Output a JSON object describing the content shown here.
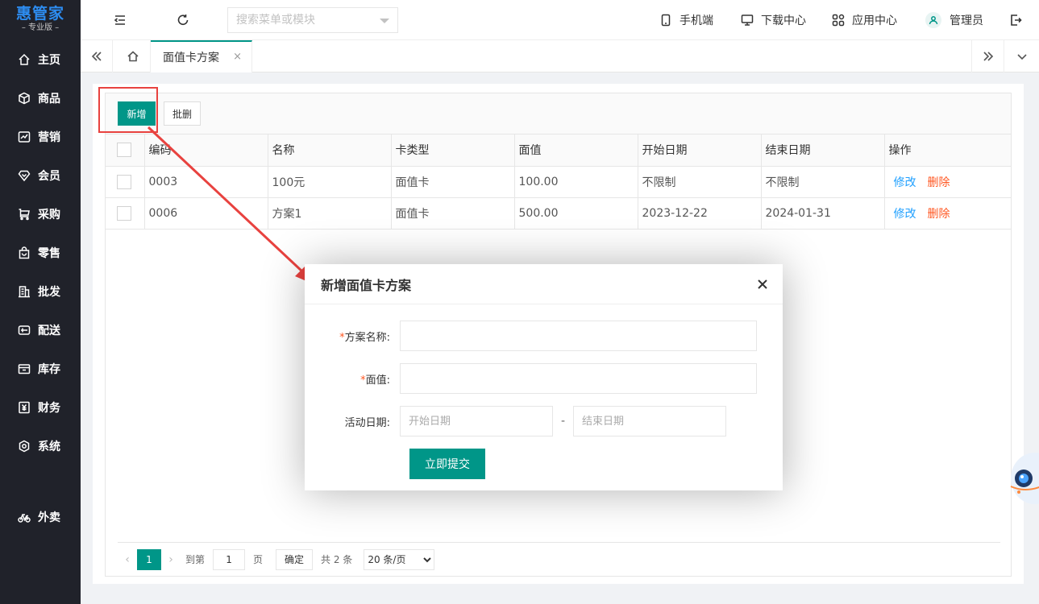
{
  "brand": {
    "title": "惠管家",
    "subtitle": "– 专业版 –"
  },
  "sidebar": {
    "items": [
      {
        "label": "主页",
        "icon": "home-icon"
      },
      {
        "label": "商品",
        "icon": "cube-icon"
      },
      {
        "label": "营销",
        "icon": "chart-icon"
      },
      {
        "label": "会员",
        "icon": "diamond-icon"
      },
      {
        "label": "采购",
        "icon": "cart-icon"
      },
      {
        "label": "零售",
        "icon": "bag-icon"
      },
      {
        "label": "批发",
        "icon": "building-icon"
      },
      {
        "label": "配送",
        "icon": "truck-icon"
      },
      {
        "label": "库存",
        "icon": "box-icon"
      },
      {
        "label": "财务",
        "icon": "yen-icon"
      },
      {
        "label": "系统",
        "icon": "settings-icon"
      },
      {
        "label": "外卖",
        "icon": "bike-icon"
      }
    ]
  },
  "header": {
    "search_placeholder": "搜索菜单或模块",
    "links": [
      {
        "label": "手机端",
        "icon": "phone-icon"
      },
      {
        "label": "下载中心",
        "icon": "monitor-icon"
      },
      {
        "label": "应用中心",
        "icon": "apps-icon"
      },
      {
        "label": "管理员",
        "icon": "user-icon"
      }
    ]
  },
  "tabs": {
    "active_label": "面值卡方案",
    "close_glyph": "×"
  },
  "toolbar": {
    "add_label": "新增",
    "batch_delete_label": "批删"
  },
  "table": {
    "columns": [
      "编码",
      "名称",
      "卡类型",
      "面值",
      "开始日期",
      "结束日期",
      "操作"
    ],
    "rows": [
      {
        "code": "0003",
        "name": "100元",
        "type": "面值卡",
        "value": "100.00",
        "start": "不限制",
        "end": "不限制"
      },
      {
        "code": "0006",
        "name": "方案1",
        "type": "面值卡",
        "value": "500.00",
        "start": "2023-12-22",
        "end": "2024-01-31"
      }
    ],
    "edit_label": "修改",
    "delete_label": "删除"
  },
  "pagination": {
    "current": "1",
    "goto_label": "到第",
    "goto_value": "1",
    "page_unit": "页",
    "confirm_label": "确定",
    "total_label": "共 2 条",
    "page_size": "20 条/页"
  },
  "modal": {
    "title": "新增面值卡方案",
    "required_mark": "*",
    "plan_name_label": "方案名称:",
    "face_value_label": "面值:",
    "date_label": "活动日期:",
    "start_placeholder": "开始日期",
    "end_placeholder": "结束日期",
    "date_separator": "-",
    "submit_label": "立即提交"
  },
  "colors": {
    "primary": "#009688",
    "sidebar": "#20222a",
    "annotation": "#e8423f",
    "link": "#1e9fff",
    "danger": "#ff5722"
  }
}
